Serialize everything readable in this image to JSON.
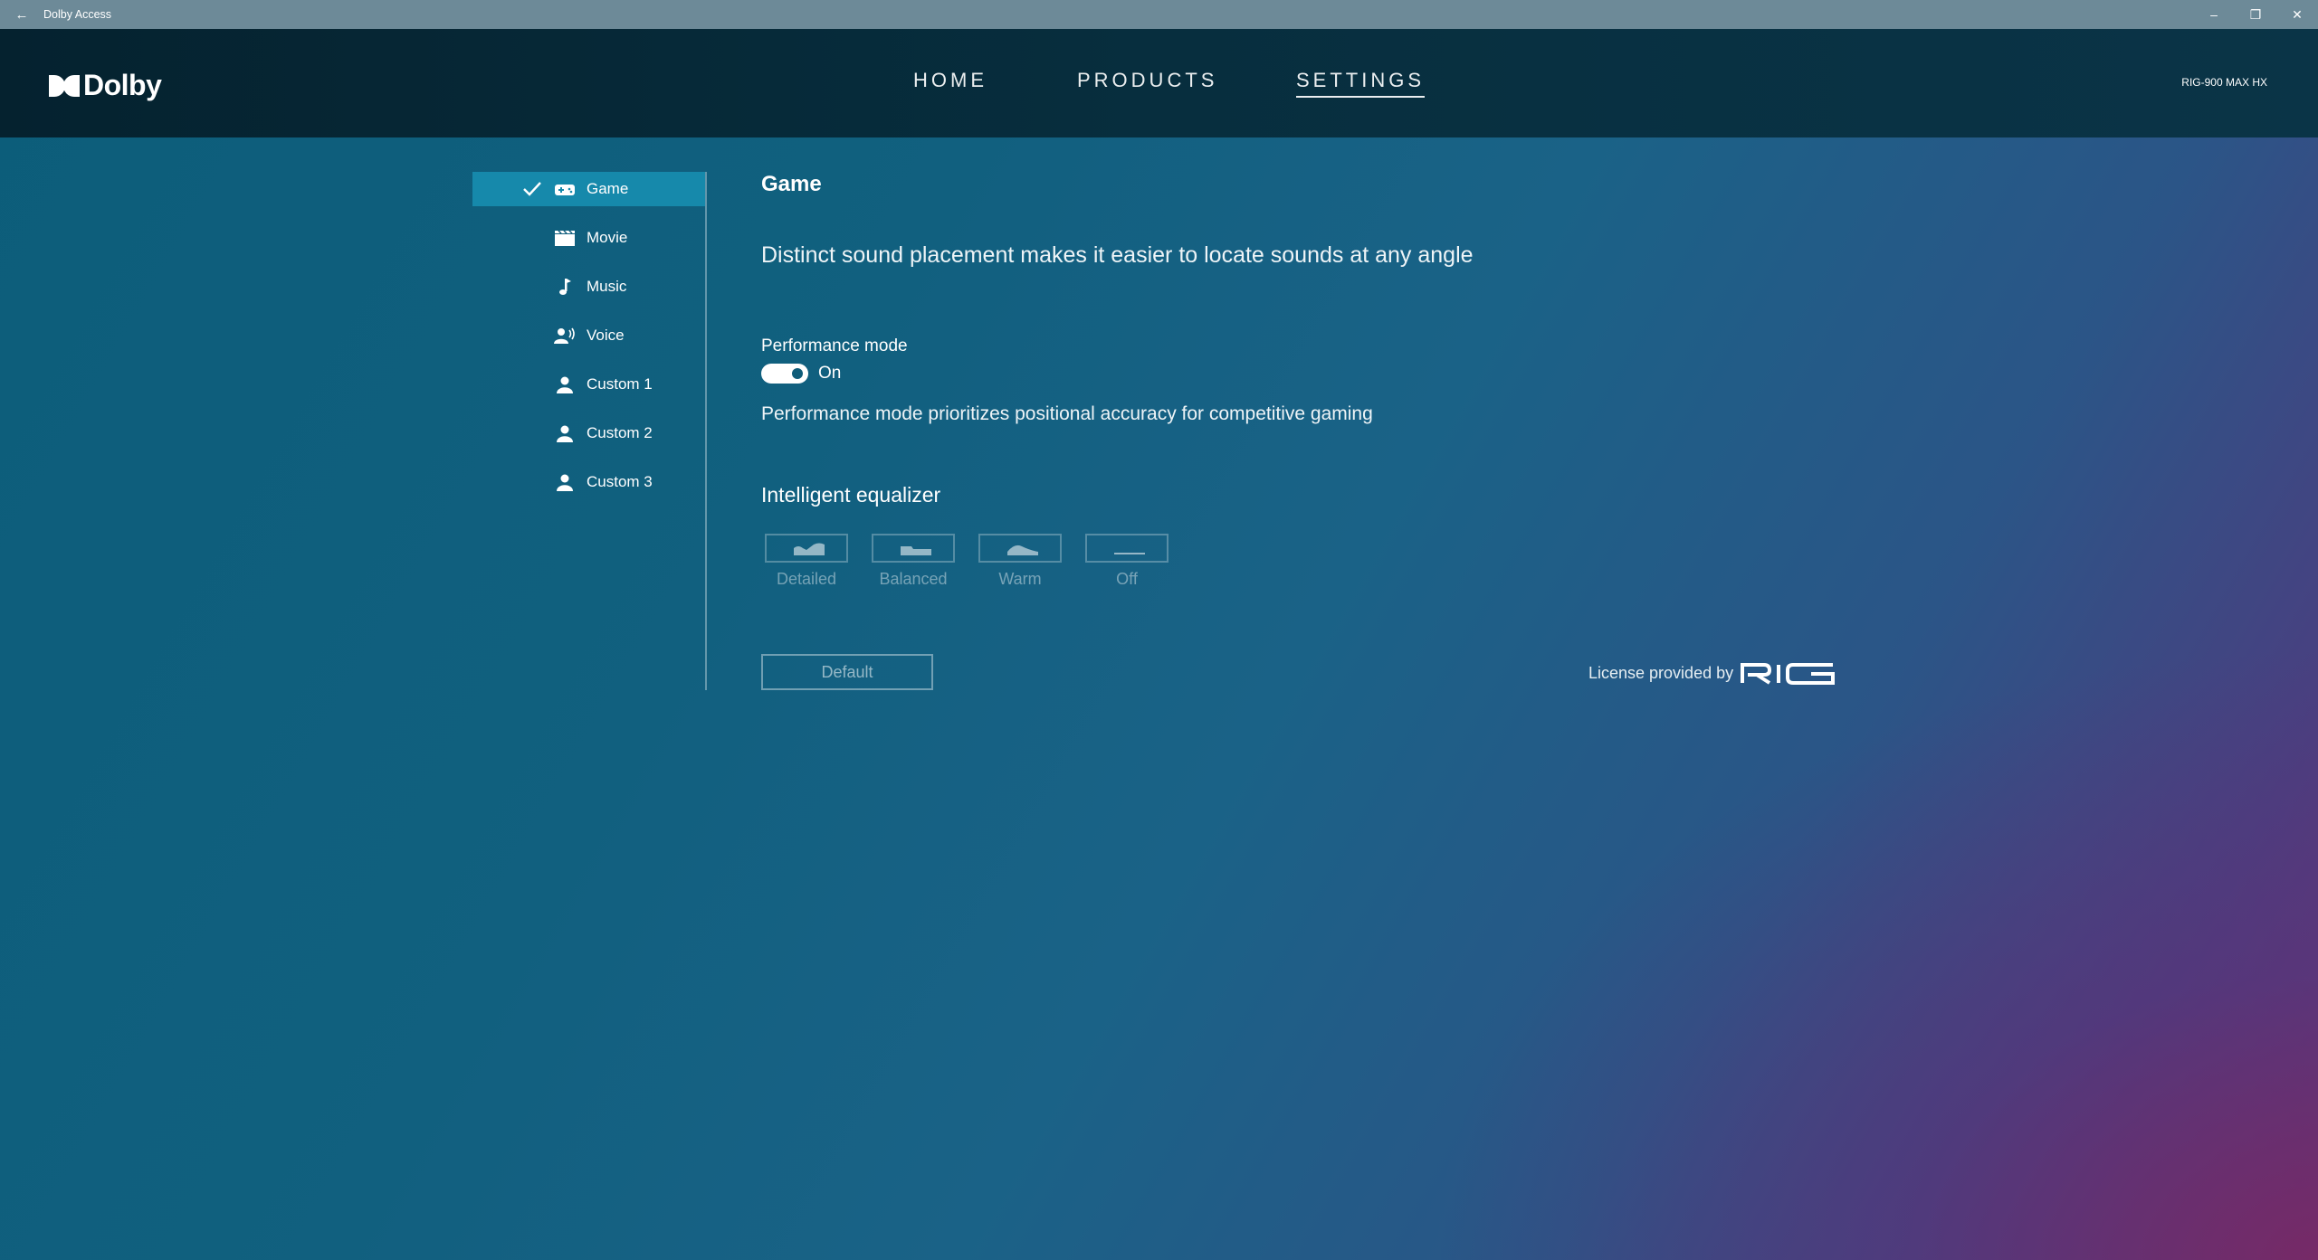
{
  "window": {
    "title": "Dolby Access"
  },
  "header": {
    "brand": "Dolby",
    "nav": [
      "HOME",
      "PRODUCTS",
      "SETTINGS"
    ],
    "active_nav": "SETTINGS",
    "device": "RIG-900 MAX HX"
  },
  "sidebar": {
    "items": [
      {
        "label": "Game",
        "icon": "gamepad-icon",
        "selected": true
      },
      {
        "label": "Movie",
        "icon": "clapperboard-icon",
        "selected": false
      },
      {
        "label": "Music",
        "icon": "music-note-icon",
        "selected": false
      },
      {
        "label": "Voice",
        "icon": "voice-icon",
        "selected": false
      },
      {
        "label": "Custom 1",
        "icon": "person-icon",
        "selected": false
      },
      {
        "label": "Custom 2",
        "icon": "person-icon",
        "selected": false
      },
      {
        "label": "Custom 3",
        "icon": "person-icon",
        "selected": false
      }
    ]
  },
  "main": {
    "title": "Game",
    "description": "Distinct sound placement makes it easier to locate sounds at any angle",
    "performance": {
      "label": "Performance mode",
      "state": "On",
      "enabled": true,
      "description": "Performance mode prioritizes positional accuracy for competitive gaming"
    },
    "equalizer": {
      "title": "Intelligent equalizer",
      "options": [
        "Detailed",
        "Balanced",
        "Warm",
        "Off"
      ]
    },
    "default_button": "Default",
    "license_text": "License provided by",
    "license_brand": "RIG"
  },
  "colors": {
    "accent": "#1689ab",
    "header_bg": "#06283a",
    "titlebar_bg": "#6d8a98"
  }
}
